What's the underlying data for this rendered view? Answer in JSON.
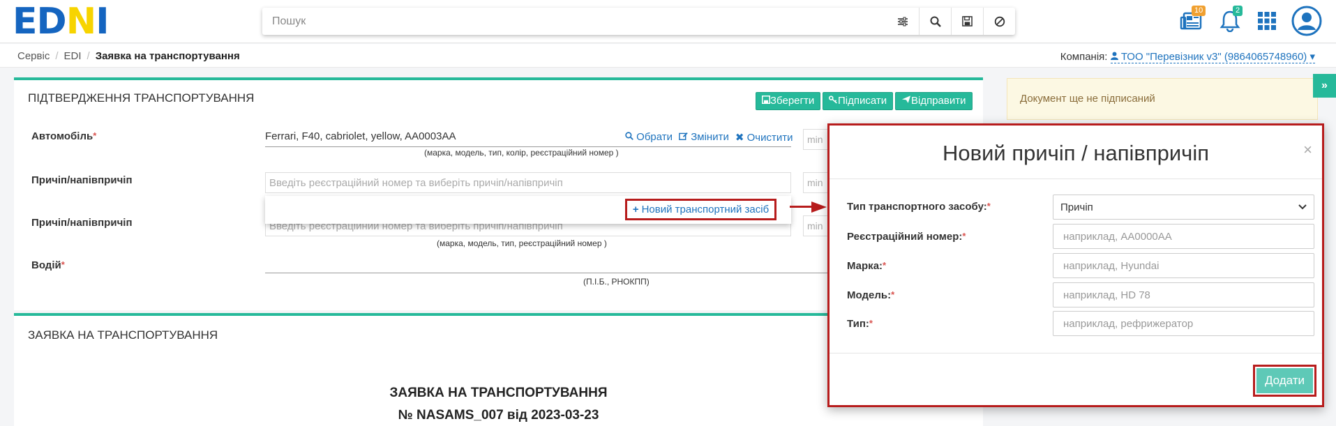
{
  "header": {
    "logo": {
      "ed": "ED",
      "n": "N",
      "i": "I"
    },
    "search_placeholder": "Пошук",
    "badges": {
      "documents": "10",
      "notifications": "2"
    },
    "colors": {
      "accent": "#26b99a",
      "brand": "#1565c0",
      "highlight": "#b71c1c"
    }
  },
  "breadcrumb": {
    "items": [
      "Сервіс",
      "EDI"
    ],
    "current": "Заявка на транспортування",
    "company_label": "Компанія:",
    "company_value": "ТОО \"Перевізник v3\" (9864065748960)"
  },
  "confirm_panel": {
    "title": "ПІДТВЕРДЖЕННЯ ТРАНСПОРТУВАННЯ",
    "buttons": {
      "save": "Зберегти",
      "sign": "Підписати",
      "send": "Відправити"
    },
    "car": {
      "label": "Автомобіль",
      "value": "Ferrari, F40, cabriolet, yellow, AA0003AA",
      "hint": "(марка, модель, тип, колір, реєстраційний номер )",
      "links": {
        "choose": "Обрати",
        "change": "Змінити",
        "clear": "Очистити"
      }
    },
    "trailer1": {
      "label": "Причіп/напівпричіп",
      "placeholder": "Введіть реєстраційний номер та виберіть причіп/напівпричіп"
    },
    "dropdown_new": "Новий транспортний засіб",
    "trailer2": {
      "label": "Причіп/напівпричіп",
      "placeholder": "Введіть реєстраційний номер та виберіть причіп/напівпричіп",
      "hint": "(марка, модель, тип, реєстраційний номер )"
    },
    "driver": {
      "label": "Водій",
      "hint": "(П.І.Б., РНОКПП)"
    },
    "side_placeholder": "min"
  },
  "request_panel": {
    "title": "ЗАЯВКА НА ТРАНСПОРТУВАННЯ",
    "doc_title": "ЗАЯВКА НА ТРАНСПОРТУВАННЯ",
    "doc_number": "№ NASAMS_007 від 2023-03-23"
  },
  "status": {
    "text": "Документ ще не підписаний"
  },
  "modal": {
    "title": "Новий причіп / напівпричіп",
    "close": "×",
    "fields": [
      {
        "label": "Тип транспортного засобу:",
        "value": "Причіп"
      },
      {
        "label": "Реєстраційний номер:",
        "placeholder": "наприклад, AA0000AA"
      },
      {
        "label": "Марка:",
        "placeholder": "наприклад, Hyundai"
      },
      {
        "label": "Модель:",
        "placeholder": "наприклад, HD 78"
      },
      {
        "label": "Тип:",
        "placeholder": "наприклад, рефрижератор"
      }
    ],
    "add_label": "Додати"
  }
}
